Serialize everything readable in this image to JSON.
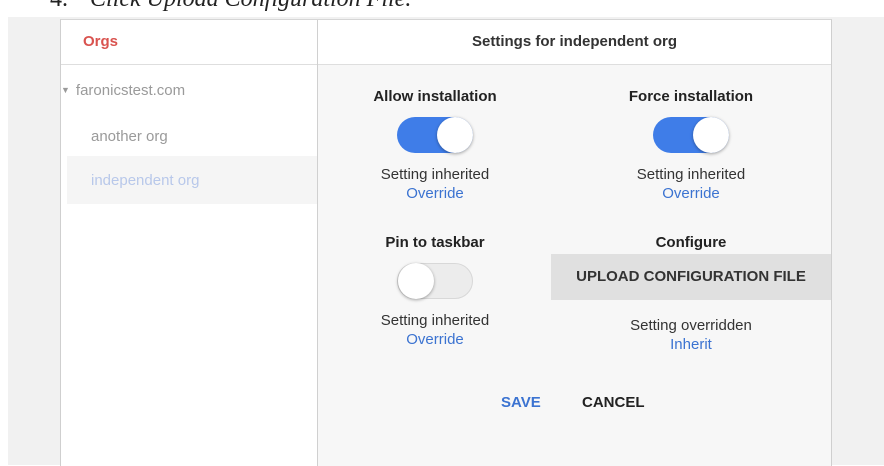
{
  "caption": {
    "number": "4.",
    "text": "Click Upload Configuration File."
  },
  "orgs_panel": {
    "header": "Orgs",
    "root_org": "faronicstest.com",
    "items": [
      {
        "label": "another org"
      },
      {
        "label": "independent org"
      }
    ]
  },
  "settings": {
    "header": "Settings for independent org",
    "allow_installation": {
      "title": "Allow installation",
      "toggle_state": "on",
      "status": "Setting inherited",
      "link": "Override"
    },
    "force_installation": {
      "title": "Force installation",
      "toggle_state": "on",
      "status": "Setting inherited",
      "link": "Override"
    },
    "pin_to_taskbar": {
      "title": "Pin to taskbar",
      "toggle_state": "off",
      "status": "Setting inherited",
      "link": "Override"
    },
    "configure": {
      "title": "Configure",
      "button": "UPLOAD CONFIGURATION FILE",
      "status": "Setting overridden",
      "link": "Inherit"
    },
    "save_label": "SAVE",
    "cancel_label": "CANCEL"
  },
  "colors": {
    "accent": "#3f7de8",
    "link": "#3b73d1",
    "orgs_header": "#d9534f"
  }
}
